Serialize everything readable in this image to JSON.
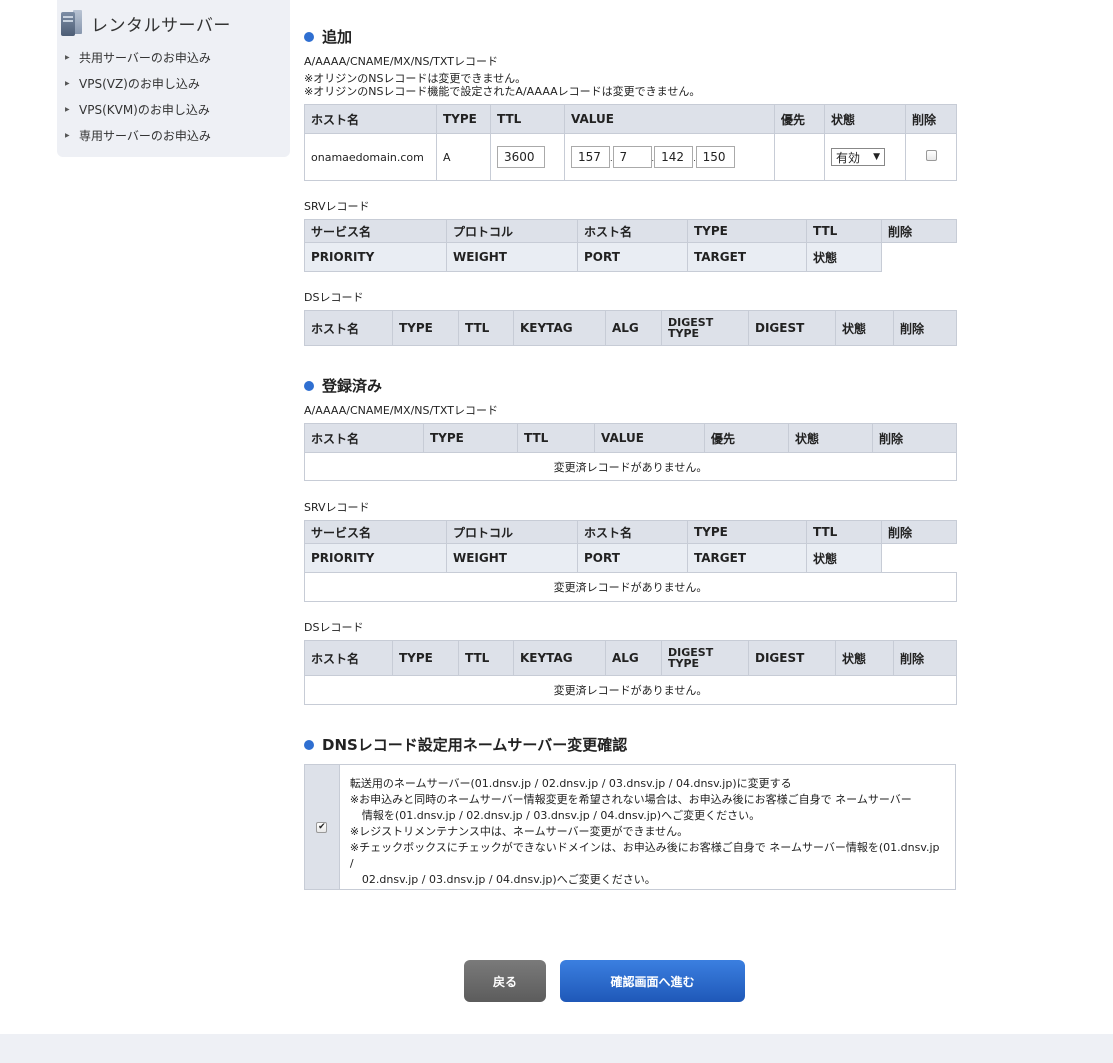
{
  "sidebar": {
    "title": "レンタルサーバー",
    "items": [
      {
        "label": "共用サーバーのお申込み"
      },
      {
        "label": "VPS(VZ)のお申し込み"
      },
      {
        "label": "VPS(KVM)のお申し込み"
      },
      {
        "label": "専用サーバーのお申込み"
      }
    ]
  },
  "add": {
    "title": "追加",
    "record_caption": "A/AAAA/CNAME/MX/NS/TXTレコード",
    "note1": "※オリジンのNSレコードは変更できません。",
    "note2": "※オリジンのNSレコード機能で設定されたA/AAAAレコードは変更できません。",
    "headers": [
      "ホスト名",
      "TYPE",
      "TTL",
      "VALUE",
      "優先",
      "状態",
      "削除"
    ],
    "row": {
      "host": "onamaedomain.com",
      "type": "A",
      "ttl": "3600",
      "ip": [
        "157",
        "7",
        "142",
        "150"
      ],
      "ip_sep": ".",
      "status": "有効",
      "status_arrow": "▼"
    },
    "srv_caption": "SRVレコード",
    "srv_headers1": [
      "サービス名",
      "プロトコル",
      "ホスト名",
      "TYPE",
      "TTL",
      "削除"
    ],
    "srv_headers2": [
      "PRIORITY",
      "WEIGHT",
      "PORT",
      "TARGET",
      "状態"
    ],
    "ds_caption": "DSレコード",
    "ds_headers": [
      "ホスト名",
      "TYPE",
      "TTL",
      "KEYTAG",
      "ALG",
      "DIGEST TYPE",
      "DIGEST",
      "状態",
      "削除"
    ]
  },
  "registered": {
    "title": "登録済み",
    "record_caption": "A/AAAA/CNAME/MX/NS/TXTレコード",
    "headers": [
      "ホスト名",
      "TYPE",
      "TTL",
      "VALUE",
      "優先",
      "状態",
      "削除"
    ],
    "empty": "変更済レコードがありません。",
    "srv_caption": "SRVレコード",
    "srv_headers1": [
      "サービス名",
      "プロトコル",
      "ホスト名",
      "TYPE",
      "TTL",
      "削除"
    ],
    "srv_headers2": [
      "PRIORITY",
      "WEIGHT",
      "PORT",
      "TARGET",
      "状態"
    ],
    "srv_empty": "変更済レコードがありません。",
    "ds_caption": "DSレコード",
    "ds_headers": [
      "ホスト名",
      "TYPE",
      "TTL",
      "KEYTAG",
      "ALG",
      "DIGEST TYPE",
      "DIGEST",
      "状態",
      "削除"
    ],
    "ds_empty": "変更済レコードがありません。"
  },
  "confirm": {
    "title": "DNSレコード設定用ネームサーバー変更確認",
    "checked": true,
    "line1": "転送用のネームサーバー(01.dnsv.jp / 02.dnsv.jp / 03.dnsv.jp / 04.dnsv.jp)に変更する",
    "line2": "※お申込みと同時のネームサーバー情報変更を希望されない場合は、お申込み後にお客様ご自身で ネームサーバー",
    "line3": "情報を(01.dnsv.jp / 02.dnsv.jp / 03.dnsv.jp / 04.dnsv.jp)へご変更ください。",
    "line4": "※レジストリメンテナンス中は、ネームサーバー変更ができません。",
    "line5": "※チェックボックスにチェックができないドメインは、お申込み後にお客様ご自身で ネームサーバー情報を(01.dnsv.jp /",
    "line6": "02.dnsv.jp / 03.dnsv.jp / 04.dnsv.jp)へご変更ください。",
    "check_glyph": "✔"
  },
  "buttons": {
    "back": "戻る",
    "next": "確認画面へ進む"
  },
  "colors": {
    "accent": "#2f6fd1",
    "header_bg": "#dde1e9",
    "back_btn": "#666666",
    "next_btn": "#2563c4"
  }
}
